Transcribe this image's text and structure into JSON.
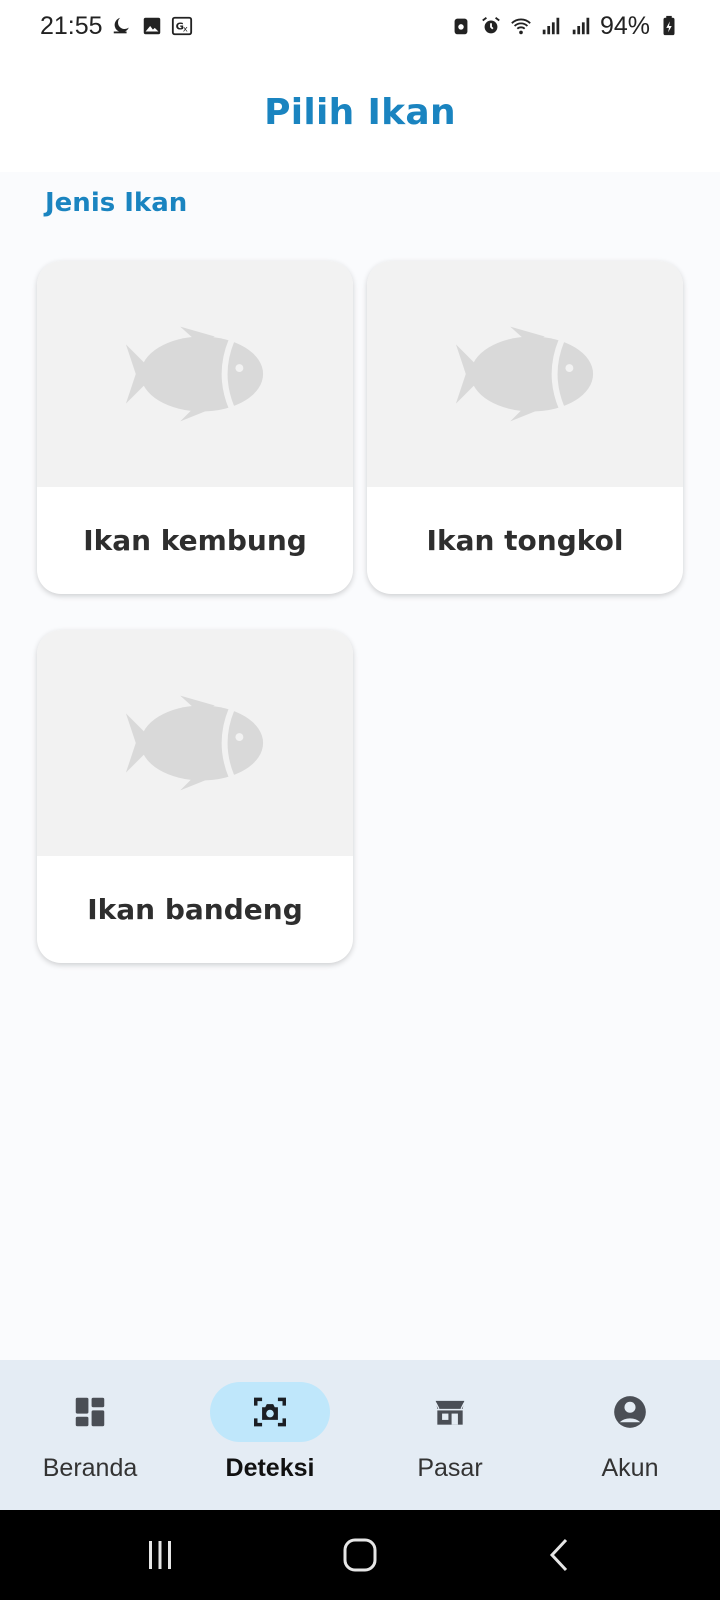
{
  "status_bar": {
    "time": "21:55",
    "battery": "94%",
    "left_icons": [
      "moon-icon",
      "image-icon",
      "translate-icon"
    ],
    "right_icons": [
      "recycle-icon",
      "alarm-icon",
      "wifi-icon",
      "signal-icon",
      "signal-icon",
      "battery-icon"
    ]
  },
  "header": {
    "title": "Pilih Ikan"
  },
  "section": {
    "title": "Jenis Ikan"
  },
  "fish_cards": [
    {
      "label": "Ikan kembung",
      "icon": "fish-icon"
    },
    {
      "label": "Ikan tongkol",
      "icon": "fish-icon"
    },
    {
      "label": "Ikan bandeng",
      "icon": "fish-icon"
    }
  ],
  "bottom_nav": {
    "items": [
      {
        "label": "Beranda",
        "icon": "dashboard-icon",
        "active": false
      },
      {
        "label": "Deteksi",
        "icon": "camera-scan-icon",
        "active": true
      },
      {
        "label": "Pasar",
        "icon": "store-icon",
        "active": false
      },
      {
        "label": "Akun",
        "icon": "account-icon",
        "active": false
      }
    ]
  },
  "system_nav": [
    "recents-icon",
    "home-icon",
    "back-icon"
  ],
  "colors": {
    "accent": "#1a84c0",
    "nav_background": "#e4ecf4",
    "active_pill": "#bfe7fb",
    "card_image_bg": "#f2f2f2",
    "fish_placeholder": "#d9d9d9"
  }
}
